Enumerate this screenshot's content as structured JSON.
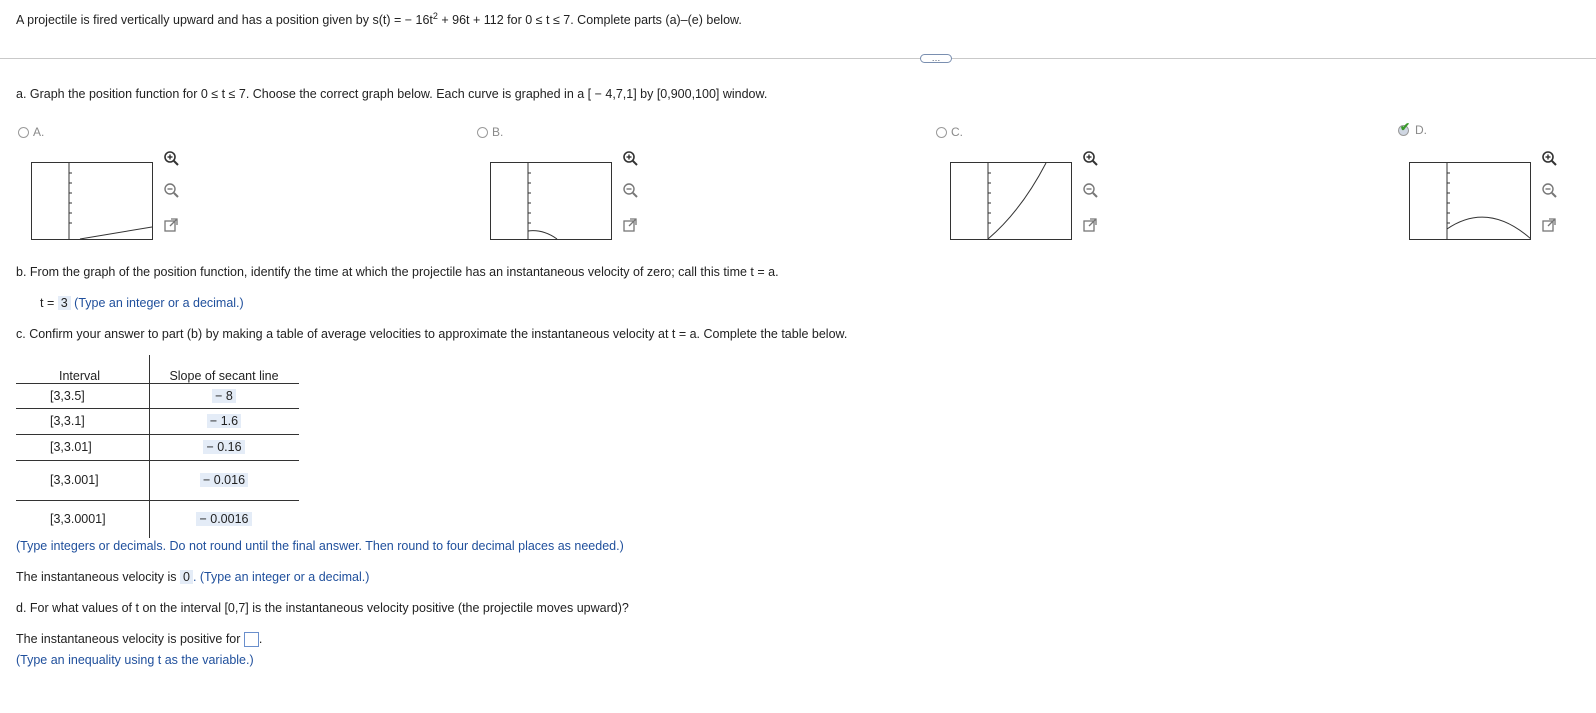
{
  "question": {
    "text_before_sup": "A projectile is fired vertically upward and has a position given by s(t) = − 16t",
    "sup": "2",
    "text_after_sup": " + 96t + 112 for 0 ≤ t ≤ 7. Complete parts (a)–(e) below."
  },
  "more_button": "…",
  "part_a": {
    "prompt": "a. Graph the position function for 0 ≤ t ≤ 7. Choose the correct graph below. Each curve is graphed in a [ − 4,7,1] by [0,900,100] window.",
    "options": [
      {
        "label": "A.",
        "selected": false
      },
      {
        "label": "B.",
        "selected": false
      },
      {
        "label": "C.",
        "selected": false
      },
      {
        "label": "D.",
        "selected": true
      }
    ]
  },
  "part_b": {
    "prompt": "b. From the graph of the position function, identify the time at which the projectile has an instantaneous velocity of zero; call this time t = a.",
    "answer_prefix": "t =",
    "answer_value": "3",
    "hint": "(Type an integer or a decimal.)"
  },
  "part_c": {
    "prompt": "c. Confirm your answer to part (b) by making a table of average velocities to approximate the instantaneous velocity at t = a. Complete the table below.",
    "table_headers": [
      "Interval",
      "Slope of secant line"
    ],
    "rows": [
      {
        "interval": "[3,3.5]",
        "slope": "− 8"
      },
      {
        "interval": "[3,3.1]",
        "slope": "− 1.6"
      },
      {
        "interval": "[3,3.01]",
        "slope": "− 0.16"
      },
      {
        "interval": "[3,3.001]",
        "slope": "− 0.016"
      },
      {
        "interval": "[3,3.0001]",
        "slope": "− 0.0016"
      }
    ],
    "table_hint": "(Type integers or decimals. Do not round until the final answer. Then round to four decimal places as needed.)",
    "velocity_prefix": "The instantaneous velocity is",
    "velocity_value": "0",
    "velocity_hint": ". (Type an integer or a decimal.)"
  },
  "part_d": {
    "prompt": "d. For what values of t on the interval [0,7] is the instantaneous velocity positive (the projectile moves upward)?",
    "answer_prefix": "The instantaneous velocity is positive for",
    "answer_value": "",
    "hint": "(Type an inequality using t as the variable.)"
  },
  "icons": [
    "zoom-in-icon",
    "zoom-out-icon",
    "popout-icon",
    "checkmark-icon"
  ],
  "colors": {
    "hint_blue": "#1f4f9c",
    "answer_bg": "#e4ecf7",
    "check_green": "#3a9a2a"
  }
}
